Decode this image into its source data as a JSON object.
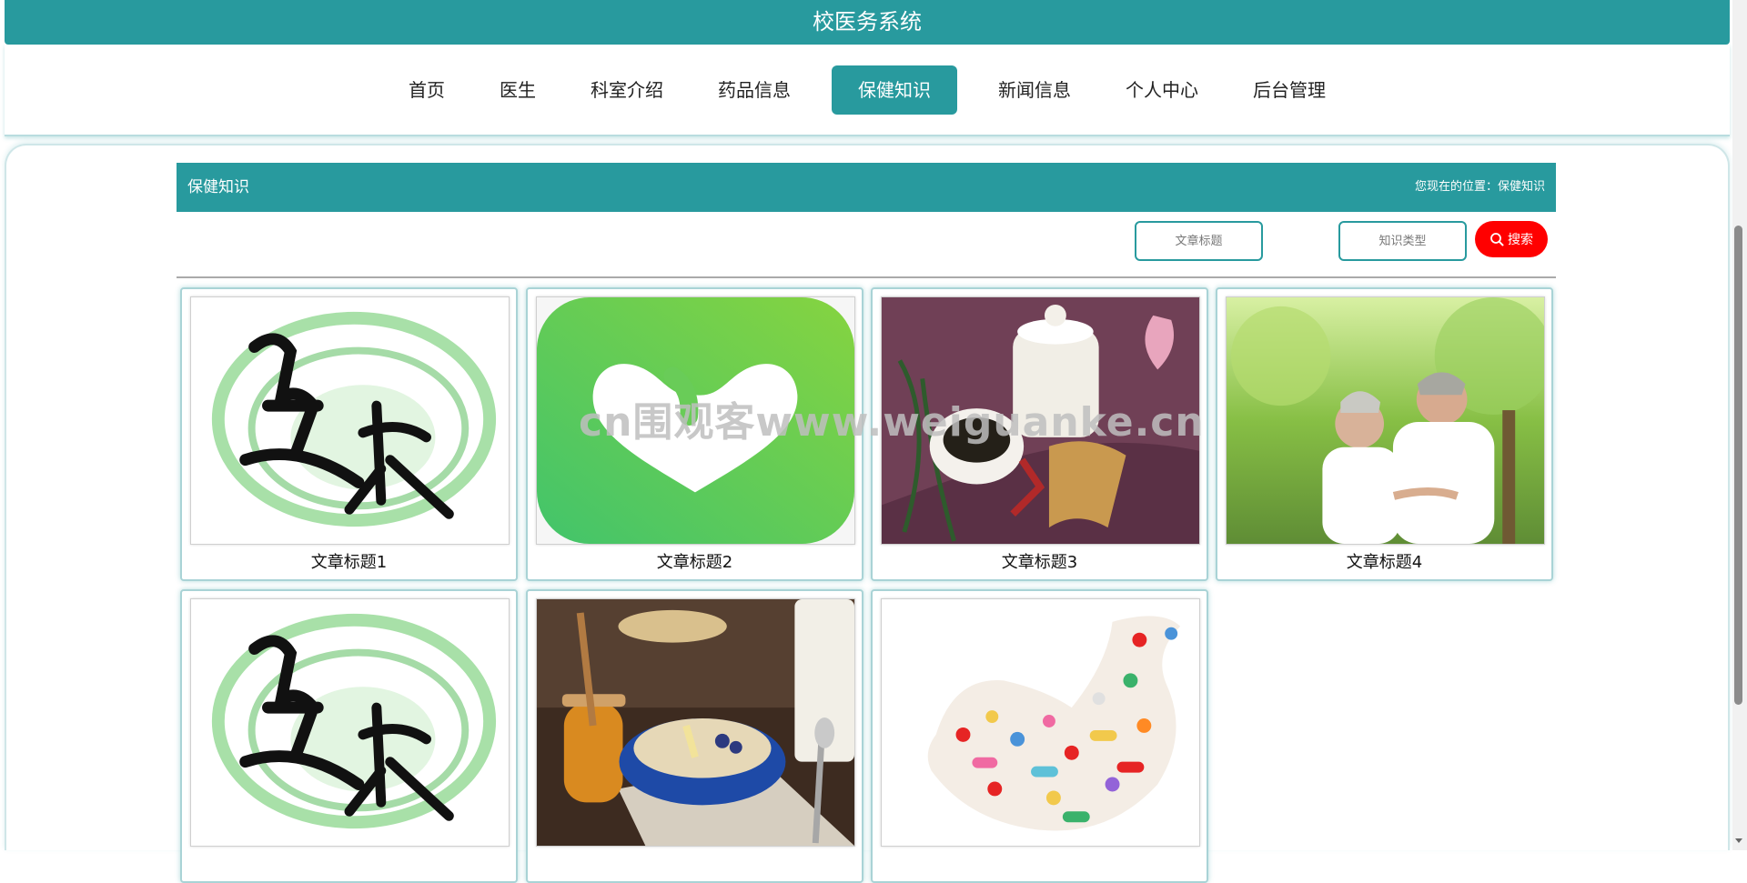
{
  "app": {
    "title": "校医务系统"
  },
  "nav": {
    "items": [
      {
        "label": "首页",
        "active": false
      },
      {
        "label": "医生",
        "active": false
      },
      {
        "label": "科室介绍",
        "active": false
      },
      {
        "label": "药品信息",
        "active": false
      },
      {
        "label": "保健知识",
        "active": true
      },
      {
        "label": "新闻信息",
        "active": false
      },
      {
        "label": "个人中心",
        "active": false
      },
      {
        "label": "后台管理",
        "active": false
      }
    ]
  },
  "section": {
    "title": "保健知识",
    "breadcrumb": "您现在的位置：保健知识"
  },
  "search": {
    "title_placeholder": "文章标题",
    "type_placeholder": "知识类型",
    "button_label": "搜索"
  },
  "articles": [
    {
      "title": "文章标题1",
      "image": "health-calligraphy"
    },
    {
      "title": "文章标题2",
      "image": "green-heart-app"
    },
    {
      "title": "文章标题3",
      "image": "herbal-medicine-pot"
    },
    {
      "title": "文章标题4",
      "image": "elderly-couple"
    },
    {
      "title": "",
      "image": "health-calligraphy"
    },
    {
      "title": "",
      "image": "oatmeal-honey"
    },
    {
      "title": "",
      "image": "pills-bird"
    }
  ],
  "watermark": "cn围观客www.weiguanke.cn",
  "colors": {
    "primary": "#289a9e",
    "search_button": "#ff0000"
  }
}
